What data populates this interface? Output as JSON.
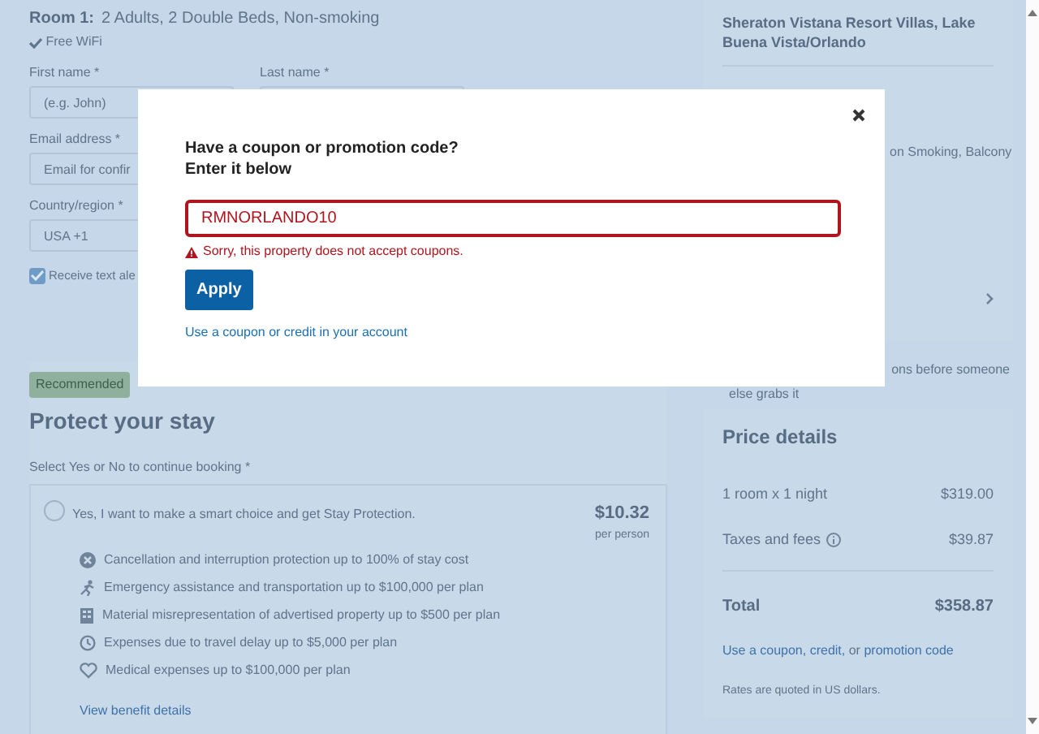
{
  "room": {
    "label": "Room 1:",
    "details": "2 Adults, 2 Double Beds, Non-smoking",
    "amenity": "Free WiFi"
  },
  "guest_form": {
    "first_name": {
      "label": "First name *",
      "placeholder": "(e.g. John)"
    },
    "last_name": {
      "label": "Last name *"
    },
    "email": {
      "label": "Email address *",
      "placeholder": "Email for confir"
    },
    "country": {
      "label": "Country/region *",
      "value": "USA +1"
    },
    "text_alerts": {
      "label": "Receive text ale",
      "checked": true
    }
  },
  "protection": {
    "badge": "Recommended",
    "title": "Protect your stay",
    "prompt": "Select Yes or No to continue booking *",
    "option": {
      "label": "Yes, I want to make a smart choice and get Stay Protection.",
      "selected": false,
      "price": "$10.32",
      "price_unit": "per person",
      "benefits": [
        "Cancellation and interruption protection up to 100% of stay cost",
        "Emergency assistance and transportation up to $100,000 per plan",
        "Material misrepresentation of advertised property up to $500 per plan",
        "Expenses due to travel delay up to $5,000 per plan",
        "Medical expenses up to $100,000 per plan"
      ],
      "link": "View benefit details"
    }
  },
  "hotel": {
    "name": "Sheraton Vistana Resort Villas, Lake Buena Vista/Orlando",
    "room_features": "on Smoking, Balcony",
    "urgency": [
      "ons before someone",
      "else grabs it"
    ]
  },
  "price_details": {
    "title": "Price details",
    "rows": [
      {
        "label": "1 room x 1 night",
        "amount": "$319.00",
        "info": false
      },
      {
        "label": "Taxes and fees",
        "amount": "$39.87",
        "info": true
      }
    ],
    "total": {
      "label": "Total",
      "amount": "$358.87"
    },
    "coupon_note": [
      {
        "text": "Use a coupon,",
        "link": true
      },
      {
        "text": "credit,",
        "link": true
      },
      {
        "text": "or",
        "link": false
      },
      {
        "text": "promotion code",
        "link": true
      }
    ],
    "currency_note": "Rates are quoted in US dollars."
  },
  "coupon_dialog": {
    "title_lines": [
      "Have a coupon or promotion code?",
      "Enter it below"
    ],
    "code": "RMNORLANDO10",
    "invalid": true,
    "error": "Sorry, this property does not accept coupons.",
    "apply": "Apply",
    "account_link": "Use a coupon or credit in your account"
  }
}
